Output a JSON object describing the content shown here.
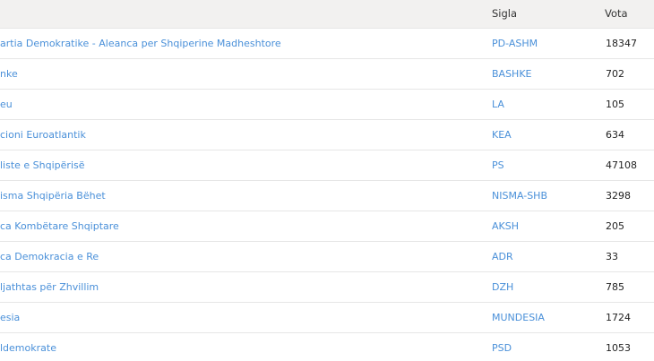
{
  "table": {
    "headers": {
      "name": "",
      "sigla": "Sigla",
      "vota": "Vota"
    },
    "rows": [
      {
        "name": "artia Demokratike - Aleanca per Shqiperine Madheshtore",
        "sigla": "PD-ASHM",
        "vota": "18347"
      },
      {
        "name": "nke",
        "sigla": "BASHKE",
        "vota": "702"
      },
      {
        "name": "eu",
        "sigla": "LA",
        "vota": "105"
      },
      {
        "name": "cioni Euroatlantik",
        "sigla": "KEA",
        "vota": "634"
      },
      {
        "name": "liste e Shqipërisë",
        "sigla": "PS",
        "vota": "47108"
      },
      {
        "name": "isma Shqipëria Bëhet",
        "sigla": "NISMA-SHB",
        "vota": "3298"
      },
      {
        "name": "ca Kombëtare Shqiptare",
        "sigla": "AKSH",
        "vota": "205"
      },
      {
        "name": "ca Demokracia e Re",
        "sigla": "ADR",
        "vota": "33"
      },
      {
        "name": "ljathtas për Zhvillim",
        "sigla": "DZH",
        "vota": "785"
      },
      {
        "name": "esia",
        "sigla": "MUNDESIA",
        "vota": "1724"
      },
      {
        "name": "ldemokrate",
        "sigla": "PSD",
        "vota": "1053"
      }
    ]
  },
  "colors": {
    "link": "#4a90d9",
    "header_bg": "#f2f1f0",
    "row_border": "#e6e6e6"
  }
}
